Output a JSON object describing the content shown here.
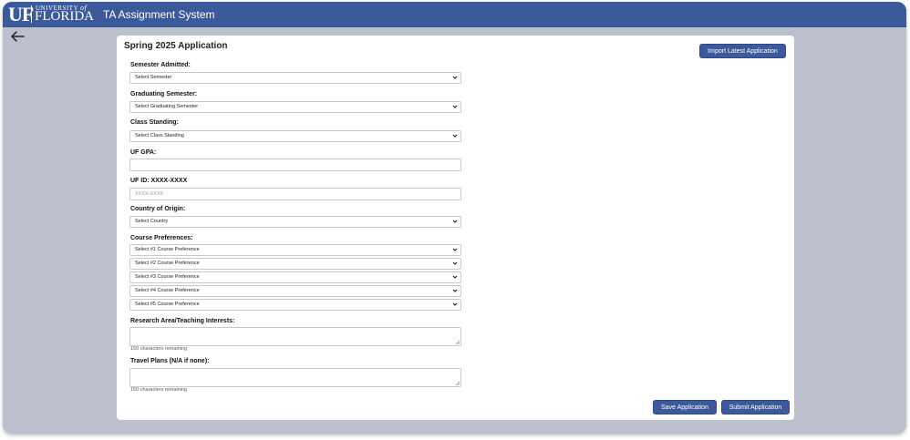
{
  "header": {
    "logo_uf": "UF",
    "logo_university": "UNIVERSITY",
    "logo_of": "of",
    "logo_florida": "FLORIDA",
    "app_title": "TA Assignment System"
  },
  "icons": {
    "back": "arrow-left-icon",
    "chevron": "chevron-down-icon",
    "resize": "resize-grip-icon"
  },
  "colors": {
    "brand": "#3b5a9c",
    "background": "#bcc0cc"
  },
  "form": {
    "title": "Spring 2025 Application",
    "import_label": "Import Latest Application",
    "semester_admitted": {
      "label": "Semester Admitted:",
      "value": "Select Semester"
    },
    "graduating_semester": {
      "label": "Graduating Semester:",
      "value": "Select Graduating Semester"
    },
    "class_standing": {
      "label": "Class Standing:",
      "value": "Select Class Standing"
    },
    "gpa": {
      "label": "UF GPA:",
      "value": ""
    },
    "ufid": {
      "label": "UF ID: XXXX-XXXX",
      "placeholder": "XXXX-XXXX"
    },
    "country": {
      "label": "Country of Origin:",
      "value": "Select Country"
    },
    "course_prefs": {
      "label": "Course Preferences:",
      "options": [
        "Select #1 Course Preference",
        "Select #2 Course Preference",
        "Select #3 Course Preference",
        "Select #4 Course Preference",
        "Select #5 Course Preference"
      ]
    },
    "research": {
      "label": "Research Area/Teaching Interests:",
      "remaining": "150 characters remaining"
    },
    "travel": {
      "label": "Travel Plans (N/A if none):",
      "remaining": "150 characters remaining"
    },
    "save_label": "Save Application",
    "submit_label": "Submit Application"
  }
}
